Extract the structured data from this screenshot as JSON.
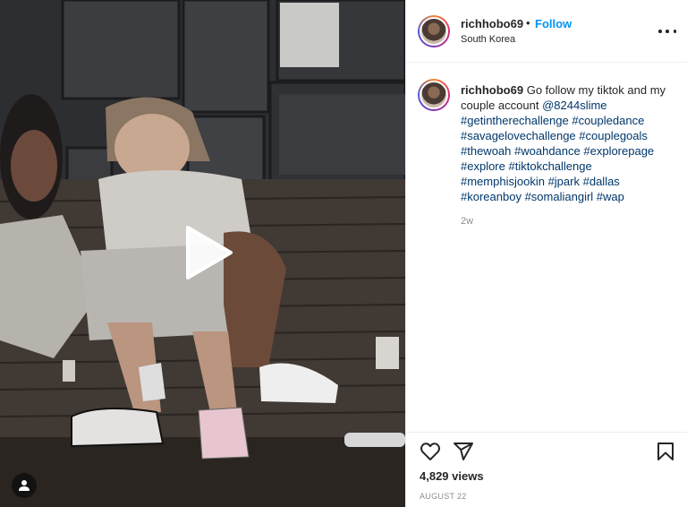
{
  "post": {
    "username": "richhobo69",
    "dot": "•",
    "follow_label": "Follow",
    "location": "South Korea"
  },
  "caption": {
    "username": "richhobo69",
    "text": "Go follow my tiktok and my couple account",
    "mention": "@8244slime",
    "hashtags": [
      "#getintherechallenge",
      "#coupledance",
      "#savagelovechallenge",
      "#couplegoals",
      "#thewoah",
      "#woahdance",
      "#explorepage",
      "#explore",
      "#tiktokchallenge",
      "#memphisjookin",
      "#jpark",
      "#dallas",
      "#koreanboy",
      "#somaliangirl",
      "#wap"
    ],
    "time": "2w"
  },
  "stats": {
    "views": "4,829 views",
    "date": "AUGUST 22"
  },
  "icons": {
    "more": "more-options-icon",
    "like": "heart-icon",
    "share": "share-icon",
    "save": "bookmark-icon",
    "play": "play-icon",
    "tag": "user-tag-icon"
  }
}
